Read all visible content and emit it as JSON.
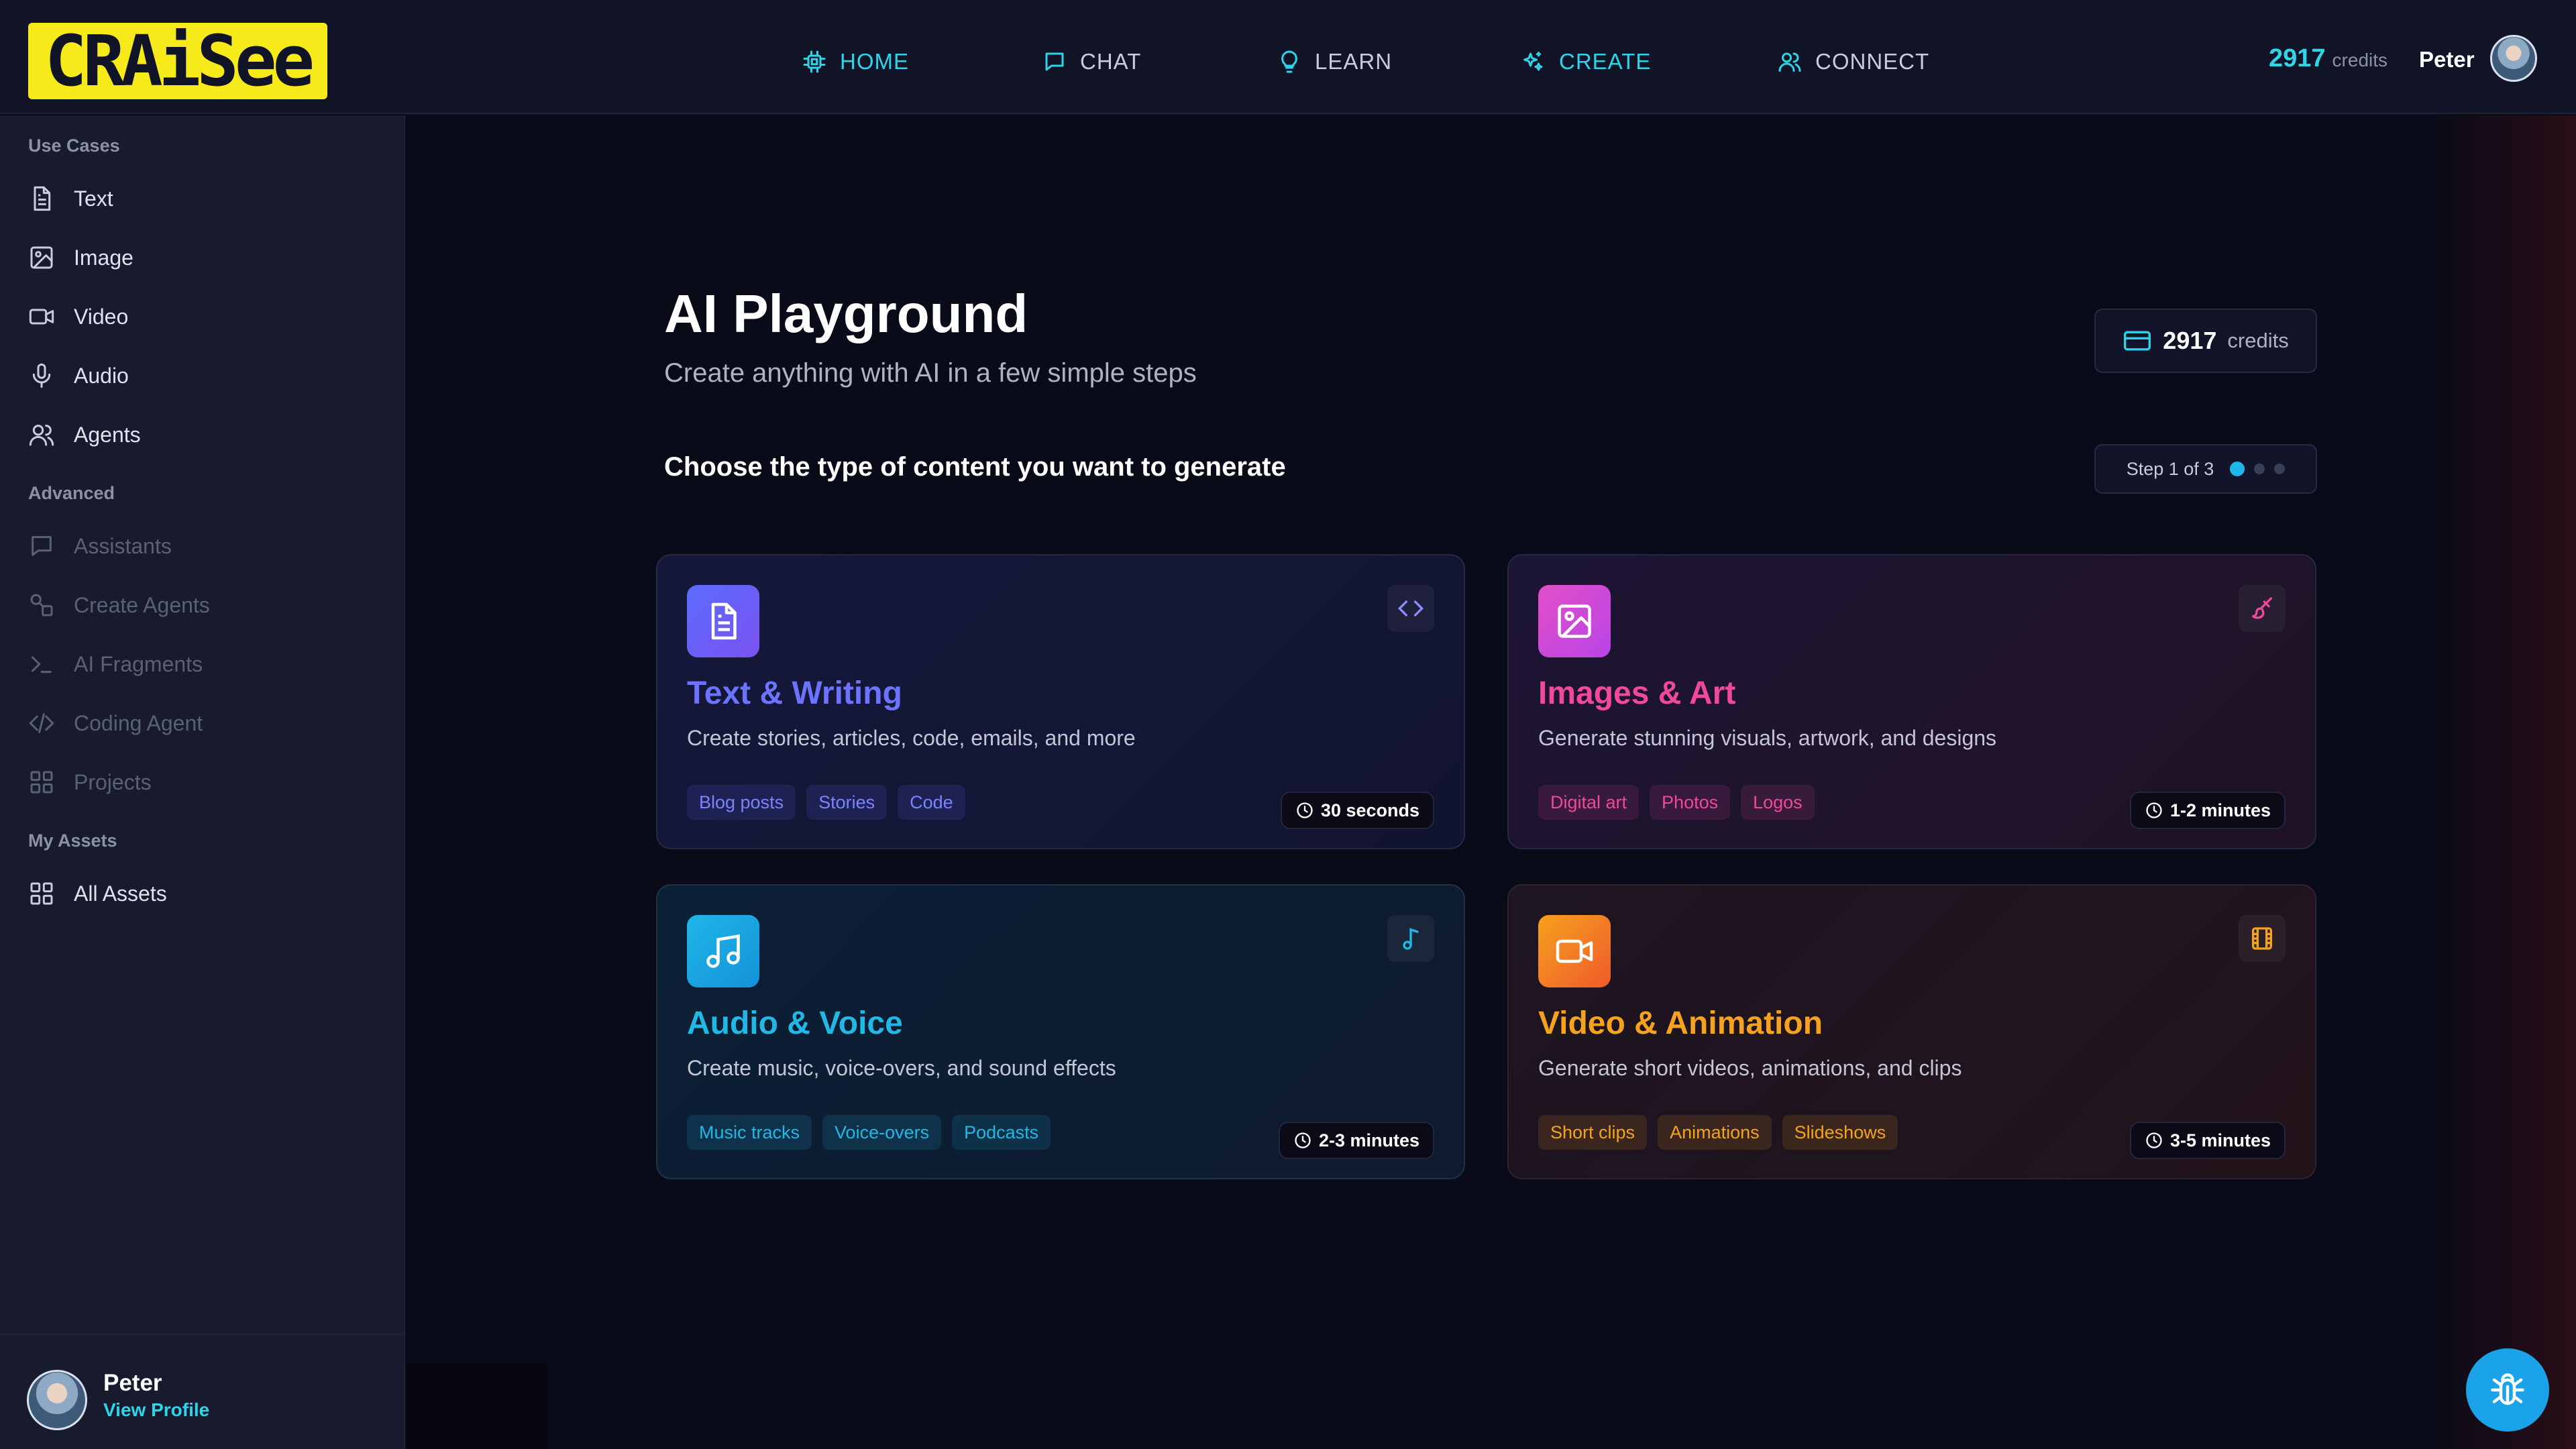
{
  "app": {
    "logo_text": "CRAiSee"
  },
  "nav": {
    "items": [
      {
        "label": "HOME",
        "accent": true
      },
      {
        "label": "CHAT",
        "accent": false
      },
      {
        "label": "LEARN",
        "accent": false
      },
      {
        "label": "CREATE",
        "accent": true
      },
      {
        "label": "CONNECT",
        "accent": false
      }
    ],
    "credits_value": "2917",
    "credits_label": "credits",
    "user_name": "Peter"
  },
  "sidebar": {
    "use_cases": {
      "label": "Use Cases",
      "items": [
        {
          "label": "Text",
          "icon": "document-icon"
        },
        {
          "label": "Image",
          "icon": "image-icon"
        },
        {
          "label": "Video",
          "icon": "video-icon"
        },
        {
          "label": "Audio",
          "icon": "microphone-icon"
        },
        {
          "label": "Agents",
          "icon": "users-icon"
        }
      ]
    },
    "advanced": {
      "label": "Advanced",
      "items": [
        {
          "label": "Assistants",
          "icon": "chat-bubble-icon"
        },
        {
          "label": "Create Agents",
          "icon": "shapes-icon"
        },
        {
          "label": "AI Fragments",
          "icon": "terminal-icon"
        },
        {
          "label": "Coding Agent",
          "icon": "code-icon"
        },
        {
          "label": "Projects",
          "icon": "grid-icon"
        }
      ]
    },
    "my_assets": {
      "label": "My Assets",
      "items": [
        {
          "label": "All Assets",
          "icon": "grid-icon"
        }
      ]
    },
    "footer": {
      "user_name": "Peter",
      "profile_link": "View Profile"
    }
  },
  "main": {
    "title": "AI Playground",
    "subtitle": "Create anything with AI in a few simple steps",
    "credits_value": "2917",
    "credits_label": "credits",
    "step_question": "Choose the type of content you want to generate",
    "step_label": "Step 1 of 3",
    "cards": [
      {
        "title": "Text & Writing",
        "description": "Create stories, articles, code, emails, and more",
        "tags": [
          "Blog posts",
          "Stories",
          "Code"
        ],
        "time": "30 seconds",
        "icon": "document-icon",
        "corner_icon": "code-icon",
        "accent": "#6b73ff"
      },
      {
        "title": "Images & Art",
        "description": "Generate stunning visuals, artwork, and designs",
        "tags": [
          "Digital art",
          "Photos",
          "Logos"
        ],
        "time": "1-2 minutes",
        "icon": "image-icon",
        "corner_icon": "paintbrush-icon",
        "accent": "#f0489a"
      },
      {
        "title": "Audio & Voice",
        "description": "Create music, voice-overs, and sound effects",
        "tags": [
          "Music tracks",
          "Voice-overs",
          "Podcasts"
        ],
        "time": "2-3 minutes",
        "icon": "music-icon",
        "corner_icon": "music-note-icon",
        "accent": "#22b8e6"
      },
      {
        "title": "Video & Animation",
        "description": "Generate short videos, animations, and clips",
        "tags": [
          "Short clips",
          "Animations",
          "Slideshows"
        ],
        "time": "3-5 minutes",
        "icon": "video-icon",
        "corner_icon": "film-icon",
        "accent": "#f5a21e"
      }
    ]
  },
  "fab": {
    "icon": "bug-icon"
  },
  "colors": {
    "brand_yellow": "#f7ea1a",
    "accent_cyan": "#2fd4e8",
    "background": "#0b0c1a",
    "sidebar": "#171b2d"
  }
}
